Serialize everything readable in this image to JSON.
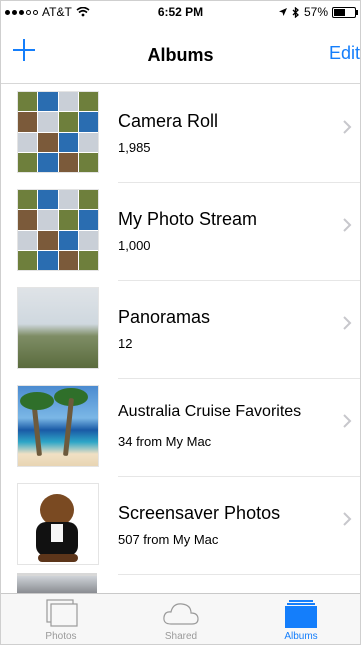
{
  "status_bar": {
    "carrier": "AT&T",
    "time": "6:52 PM",
    "battery_percent": "57%",
    "battery_level": 0.57
  },
  "nav_bar": {
    "add_icon": "plus-icon",
    "title": "Albums",
    "edit_label": "Edit"
  },
  "albums": [
    {
      "name": "Camera Roll",
      "count": "1,985"
    },
    {
      "name": "My Photo Stream",
      "count": "1,000"
    },
    {
      "name": "Panoramas",
      "count": "12"
    },
    {
      "name": "Australia Cruise Favorites",
      "count": "34 from My Mac"
    },
    {
      "name": "Screensaver Photos",
      "count": "507 from My Mac"
    }
  ],
  "tab_bar": {
    "tabs": [
      {
        "label": "Photos",
        "icon": "photos-icon"
      },
      {
        "label": "Shared",
        "icon": "cloud-icon"
      },
      {
        "label": "Albums",
        "icon": "albums-icon",
        "active": true
      }
    ]
  },
  "colors": {
    "accent": "#147efb",
    "inactive": "#9a9a9a"
  }
}
